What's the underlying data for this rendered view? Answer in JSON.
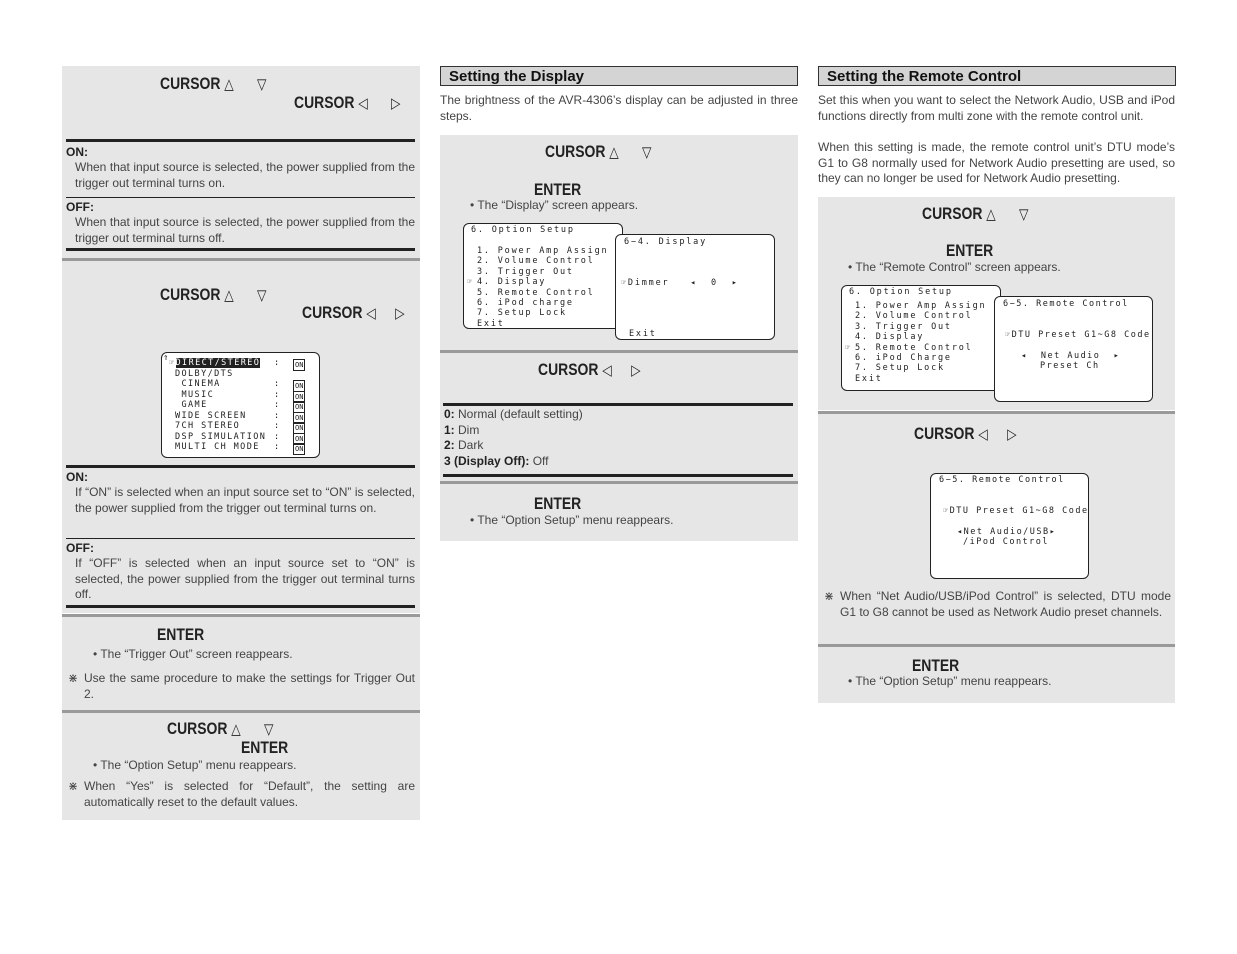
{
  "left": {
    "p1": {
      "cursor_ud": "CURSOR",
      "cursor_lr": "CURSOR",
      "up": "△",
      "down": "▽",
      "left": "◁",
      "right": "▷",
      "on_label": "ON:",
      "on_text": "When that input source is selected, the power supplied from the trigger out terminal turns on.",
      "off_label": "OFF:",
      "off_text": "When that input source is selected, the power supplied from the trigger out terminal turns off."
    },
    "p2": {
      "cursor_ud": "CURSOR",
      "cursor_lr": "CURSOR",
      "up": "△",
      "down": "▽",
      "left": "◁",
      "right": "▷",
      "osd": {
        "rows": [
          {
            "label": "DIRECT/STEREO",
            "value": "ON",
            "selected": true
          },
          {
            "label": "DOLBY/DTS",
            "value": ""
          },
          {
            "label": " CINEMA",
            "value": "ON"
          },
          {
            "label": " MUSIC",
            "value": "ON"
          },
          {
            "label": " GAME",
            "value": "ON"
          },
          {
            "label": "WIDE SCREEN",
            "value": "ON"
          },
          {
            "label": "7CH STEREO",
            "value": "ON"
          },
          {
            "label": "DSP SIMULATION",
            "value": "ON"
          },
          {
            "label": "MULTI CH MODE",
            "value": "ON"
          }
        ]
      },
      "on_label": "ON:",
      "on_text": "If “ON” is selected when an input source set to “ON” is selected, the power supplied from the trigger out terminal turns on.",
      "off_label": "OFF:",
      "off_text": "If “OFF” is selected when an input source set to “ON” is selected, the power supplied from the trigger out terminal turns off."
    },
    "p3": {
      "enter": "ENTER",
      "bullet": "• The “Trigger Out” screen reappears.",
      "note": "Use the same procedure to make the settings for Trigger Out 2."
    },
    "p4": {
      "cursor": "CURSOR",
      "up": "△",
      "down": "▽",
      "enter": "ENTER",
      "bullet": "• The “Option Setup” menu reappears.",
      "note": "When “Yes” is selected for “Default”, the setting are automatically reset to the default values."
    }
  },
  "middle": {
    "heading": "Setting the Display",
    "intro": "The brightness of the AVR-4306’s display can be adjusted in three steps.",
    "p1": {
      "cursor": "CURSOR",
      "up": "△",
      "down": "▽",
      "enter": "ENTER",
      "bullet": "• The “Display” screen appears.",
      "menu": {
        "title": "6. Option Setup",
        "items": [
          "1. Power Amp Assign",
          "2. Volume Control",
          "3. Trigger Out",
          "4. Display",
          "5. Remote Control",
          "6. iPod charge",
          "7. Setup Lock",
          "Exit"
        ],
        "selected_index": 3
      },
      "screen": {
        "title": "6−4. Display",
        "setting": "Dimmer",
        "value": "0",
        "exit": "Exit"
      }
    },
    "p2": {
      "cursor": "CURSOR",
      "left": "◁",
      "right": "▷",
      "options": [
        {
          "key": "0:",
          "desc": "Normal (default setting)"
        },
        {
          "key": "1:",
          "desc": "Dim"
        },
        {
          "key": "2:",
          "desc": "Dark"
        },
        {
          "key": "3 (Display Off):",
          "desc": "Off"
        }
      ]
    },
    "p3": {
      "enter": "ENTER",
      "bullet": "• The “Option Setup” menu reappears."
    }
  },
  "right": {
    "heading": "Setting the Remote Control",
    "intro1": "Set this when you want to select the Network Audio, USB and iPod functions directly from multi zone with the remote control unit.",
    "intro2": "When this setting is made, the remote control unit’s DTU mode’s G1 to G8 normally used for Network Audio presetting are used, so they can no longer be used for Network Audio presetting.",
    "p1": {
      "cursor": "CURSOR",
      "up": "△",
      "down": "▽",
      "enter": "ENTER",
      "bullet": "• The “Remote Control” screen appears.",
      "menu": {
        "title": "6. Option Setup",
        "items": [
          "1. Power Amp Assign",
          "2. Volume Control",
          "3. Trigger Out",
          "4. Display",
          "5. Remote Control",
          "6. iPod Charge",
          "7. Setup Lock",
          "Exit"
        ],
        "selected_index": 4
      },
      "screen": {
        "title": "6−5. Remote Control",
        "setting": "DTU Preset G1~G8 Code",
        "value1": "Net Audio",
        "value2": "Preset Ch"
      }
    },
    "p2": {
      "cursor": "CURSOR",
      "left": "◁",
      "right": "▷",
      "screen": {
        "title": "6−5. Remote Control",
        "setting": "DTU Preset G1~G8 Code",
        "value1": "Net Audio/USB",
        "value2": "/iPod Control"
      },
      "note": "When “Net Audio/USB/iPod Control” is selected, DTU mode G1 to G8 cannot be used as Network Audio preset channels."
    },
    "p3": {
      "enter": "ENTER",
      "bullet": "• The “Option Setup” menu reappears."
    }
  }
}
